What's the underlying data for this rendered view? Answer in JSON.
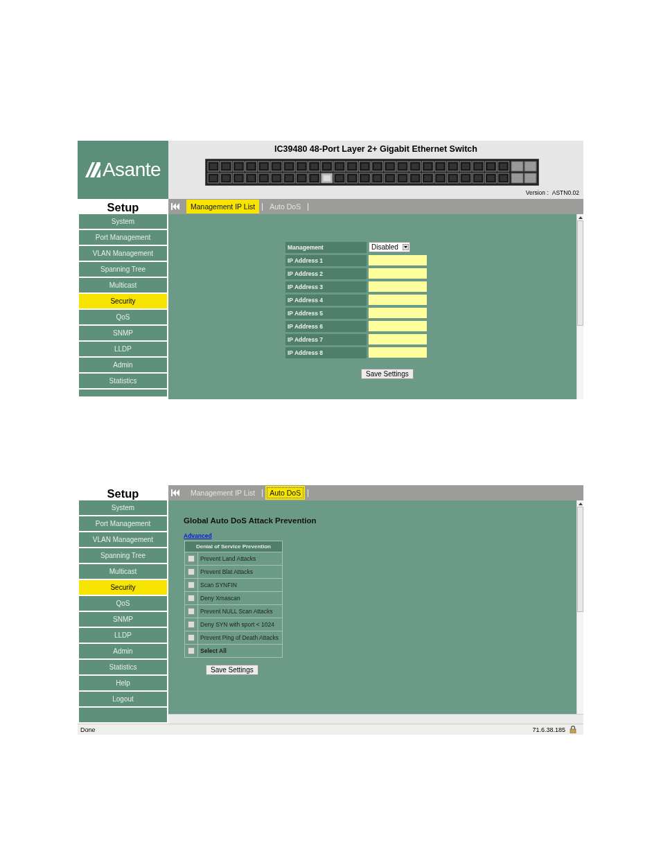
{
  "screens": [
    {
      "kind": "ip_list",
      "header": {
        "logo": "Asante",
        "title": "IC39480 48-Port Layer 2+ Gigabit Ethernet Switch",
        "version_label": "Version :",
        "version": "ASTN0.02"
      },
      "sidebar": {
        "title": "Setup",
        "cut_item": true,
        "items": [
          {
            "label": "System",
            "selected": false
          },
          {
            "label": "Port Management",
            "selected": false
          },
          {
            "label": "VLAN Management",
            "selected": false
          },
          {
            "label": "Spanning Tree",
            "selected": false
          },
          {
            "label": "Multicast",
            "selected": false
          },
          {
            "label": "Security",
            "selected": true
          },
          {
            "label": "QoS",
            "selected": false
          },
          {
            "label": "SNMP",
            "selected": false
          },
          {
            "label": "LLDP",
            "selected": false
          },
          {
            "label": "Admin",
            "selected": false
          },
          {
            "label": "Statistics",
            "selected": false
          }
        ]
      },
      "tabs": [
        {
          "label": "Management IP List",
          "selected": true
        },
        {
          "label": "Auto DoS",
          "selected": false
        }
      ],
      "form": {
        "management_label": "Management",
        "management_value": "Disabled",
        "addresses": [
          "IP Address 1",
          "IP Address 2",
          "IP Address 3",
          "IP Address 4",
          "IP Address 5",
          "IP Address 6",
          "IP Address 7",
          "IP Address 8"
        ],
        "button": "Save Settings"
      }
    },
    {
      "kind": "auto_dos",
      "sidebar": {
        "title": "Setup",
        "cut_item": false,
        "items": [
          {
            "label": "System",
            "selected": false
          },
          {
            "label": "Port Management",
            "selected": false
          },
          {
            "label": "VLAN Management",
            "selected": false
          },
          {
            "label": "Spanning Tree",
            "selected": false
          },
          {
            "label": "Multicast",
            "selected": false
          },
          {
            "label": "Security",
            "selected": true
          },
          {
            "label": "QoS",
            "selected": false
          },
          {
            "label": "SNMP",
            "selected": false
          },
          {
            "label": "LLDP",
            "selected": false
          },
          {
            "label": "Admin",
            "selected": false
          },
          {
            "label": "Statistics",
            "selected": false
          },
          {
            "label": "Help",
            "selected": false
          },
          {
            "label": "Logout",
            "selected": false
          }
        ]
      },
      "tabs": [
        {
          "label": "Management IP List",
          "selected": false
        },
        {
          "label": "Auto DoS",
          "selected": true
        }
      ],
      "dos": {
        "title": "Global Auto DoS Attack Prevention",
        "link": "Advanced",
        "table_header": "Denial of Service Prevention",
        "options": [
          {
            "label": "Prevent Land Attacks",
            "checked": false,
            "kind": "option"
          },
          {
            "label": "Prevent Blat Attacks",
            "checked": false,
            "kind": "option"
          },
          {
            "label": "Scan SYNFIN",
            "checked": false,
            "kind": "option"
          },
          {
            "label": "Deny Xmascan",
            "checked": false,
            "kind": "option"
          },
          {
            "label": "Prevent NULL Scan Attacks",
            "checked": false,
            "kind": "option"
          },
          {
            "label": "Deny SYN with sport < 1024",
            "checked": false,
            "kind": "option"
          },
          {
            "label": "Prevent Ping of Death Attacks",
            "checked": false,
            "kind": "option"
          },
          {
            "label": "Select All",
            "checked": false,
            "kind": "select_all"
          }
        ],
        "button": "Save Settings"
      },
      "status": {
        "text": "Done",
        "address": "71.6.38.185"
      }
    }
  ]
}
